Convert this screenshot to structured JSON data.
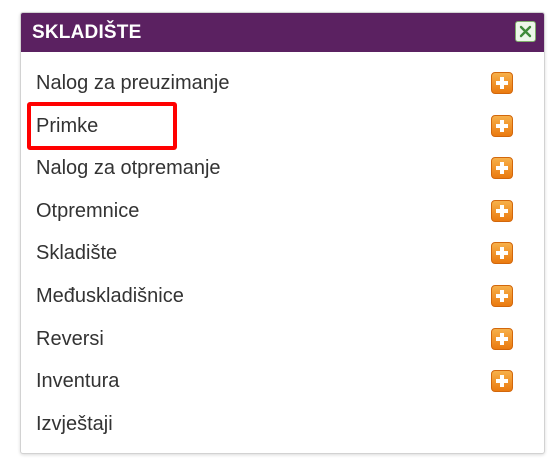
{
  "panel": {
    "title": "SKLADIŠTE",
    "header_color": "#5b2161",
    "close_icon": "close-icon"
  },
  "menu": {
    "items": [
      {
        "label": "Nalog za preuzimanje",
        "has_add": true
      },
      {
        "label": "Primke",
        "has_add": true
      },
      {
        "label": "Nalog za otpremanje",
        "has_add": true
      },
      {
        "label": "Otpremnice",
        "has_add": true
      },
      {
        "label": "Skladište",
        "has_add": true
      },
      {
        "label": "Međuskladišnice",
        "has_add": true
      },
      {
        "label": "Reversi",
        "has_add": true
      },
      {
        "label": "Inventura",
        "has_add": true
      },
      {
        "label": "Izvještaji",
        "has_add": false
      }
    ],
    "add_icon": "plus-icon",
    "add_icon_color": "#f39423"
  },
  "annotation": {
    "highlighted_item": "Primke",
    "color": "#ff0000"
  }
}
